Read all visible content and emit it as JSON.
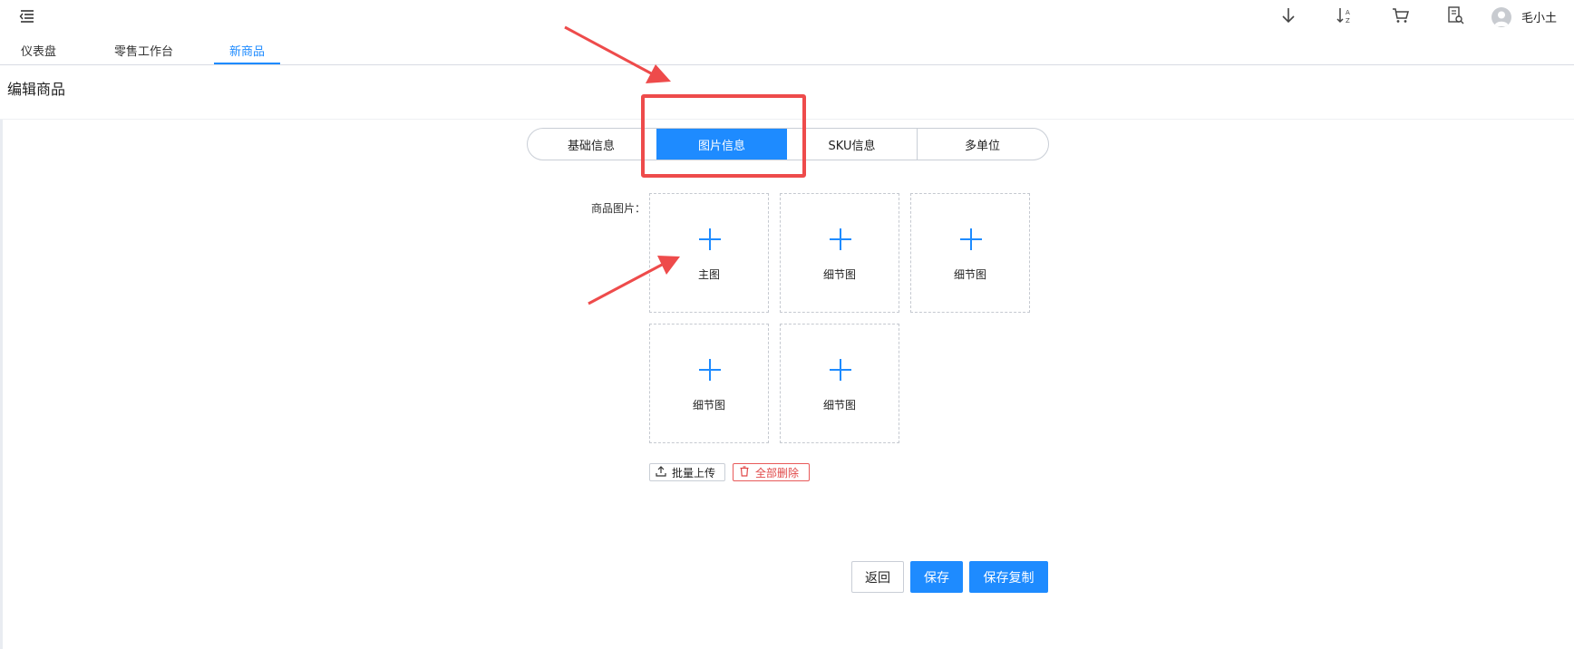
{
  "topbar": {
    "username": "毛小土",
    "icons": [
      "menu-toggle-icon",
      "download-icon",
      "sort-icon",
      "cart-icon",
      "report-search-icon",
      "user-avatar-icon"
    ]
  },
  "nav_tabs": [
    {
      "label": "仪表盘",
      "active": false
    },
    {
      "label": "零售工作台",
      "active": false
    },
    {
      "label": "新商品",
      "active": true
    }
  ],
  "page": {
    "title": "编辑商品"
  },
  "section_tabs": [
    {
      "label": "基础信息",
      "active": false
    },
    {
      "label": "图片信息",
      "active": true
    },
    {
      "label": "SKU信息",
      "active": false
    },
    {
      "label": "多单位",
      "active": false
    }
  ],
  "images": {
    "label": "商品图片：",
    "slots": [
      {
        "label": "主图"
      },
      {
        "label": "细节图"
      },
      {
        "label": "细节图"
      },
      {
        "label": "细节图"
      },
      {
        "label": "细节图"
      }
    ],
    "batch_upload_label": "批量上传",
    "delete_all_label": "全部删除"
  },
  "actions": {
    "back_label": "返回",
    "save_label": "保存",
    "save_copy_label": "保存复制"
  },
  "colors": {
    "primary": "#1e8bff",
    "danger": "#e04848",
    "annotation": "#ee4b4b"
  }
}
